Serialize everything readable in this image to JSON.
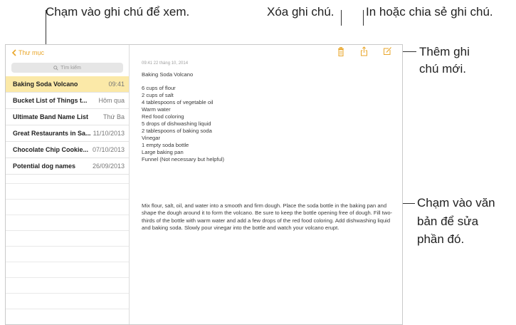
{
  "callouts": {
    "view_note": "Chạm vào ghi chú để xem.",
    "delete_note": "Xóa ghi chú.",
    "print_share": "In hoặc chia sẻ ghi chú.",
    "new_note_line1": "Thêm ghi",
    "new_note_line2": "chú mới.",
    "edit_text_line1": "Chạm vào văn",
    "edit_text_line2": "bản để sửa",
    "edit_text_line3": "phần đó."
  },
  "sidebar": {
    "back_label": "Thư mục",
    "search_placeholder": "Tìm kiếm",
    "notes": [
      {
        "title": "Baking Soda Volcano",
        "date": "09:41",
        "selected": true
      },
      {
        "title": "Bucket List of Things t...",
        "date": "Hôm qua"
      },
      {
        "title": "Ultimate Band Name List",
        "date": "Thứ Ba"
      },
      {
        "title": "Great Restaurants in Sa...",
        "date": "11/10/2013"
      },
      {
        "title": "Chocolate Chip Cookie...",
        "date": "07/10/2013"
      },
      {
        "title": "Potential dog names",
        "date": "26/09/2013"
      }
    ]
  },
  "toolbar": {
    "icons": [
      "trash-icon",
      "share-icon",
      "compose-icon"
    ],
    "accent": "#e9a62a"
  },
  "note": {
    "timestamp": "09:41 22 tháng 10, 2014",
    "title": "Baking Soda Volcano",
    "ingredients": [
      "6 cups of flour",
      "2 cups of salt",
      "4 tablespoons of vegetable oil",
      "Warm water",
      "Red food coloring",
      "5 drops of dishwashing liquid",
      "2 tablespoons of baking soda",
      "Vinegar",
      "1 empty soda bottle",
      "Large baking pan",
      "Funnel (Not necessary but helpful)"
    ],
    "instructions": "Mix flour, salt, oil, and water into a smooth and firm dough. Place the soda bottle in the baking pan and shape the dough around it to form the volcano. Be sure to keep the bottle opening free of dough. Fill two-thirds of the bottle with warm water and add a few drops of the red food coloring. Add dishwashing liquid and baking soda. Slowly pour vinegar into the bottle and watch your volcano erupt."
  }
}
